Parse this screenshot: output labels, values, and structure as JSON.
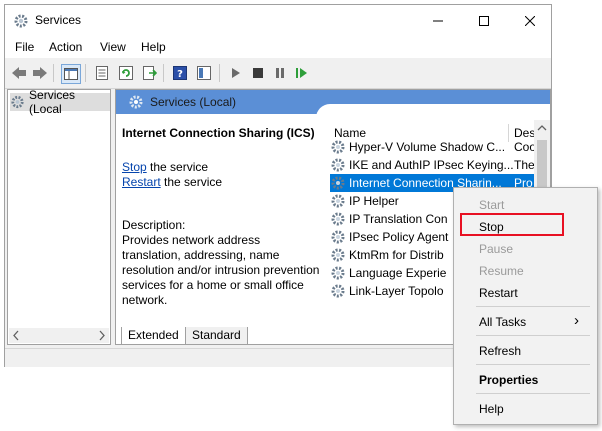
{
  "window": {
    "title": "Services",
    "controls": {
      "minimize": "—",
      "maximize": "☐",
      "close": "✕"
    }
  },
  "menu": [
    "File",
    "Action",
    "View",
    "Help"
  ],
  "tree": {
    "root_label": "Services (Local"
  },
  "content": {
    "header_title": "Services (Local)",
    "service_title": "Internet Connection Sharing (ICS)",
    "stop_link": "Stop",
    "stop_suffix": " the service",
    "restart_link": "Restart",
    "restart_suffix": " the service",
    "description_label": "Description:",
    "description_text": "Provides network address translation, addressing, name resolution and/or intrusion prevention services for a home or small office network."
  },
  "list": {
    "col_name": "Name",
    "col_desc": "Des",
    "rows": [
      {
        "name": "Hyper-V Volume Shadow C...",
        "desc": "Coo"
      },
      {
        "name": "IKE and AuthIP IPsec Keying...",
        "desc": "The"
      },
      {
        "name": "Internet Connection Sharin...",
        "desc": "Pro"
      },
      {
        "name": "IP Helper",
        "desc": ""
      },
      {
        "name": "IP Translation Con",
        "desc": ""
      },
      {
        "name": "IPsec Policy Agent",
        "desc": ""
      },
      {
        "name": "KtmRm for Distrib",
        "desc": ""
      },
      {
        "name": "Language Experie",
        "desc": ""
      },
      {
        "name": "Link-Layer Topolo",
        "desc": ""
      }
    ],
    "selected_index": 2
  },
  "tabs": [
    "Extended",
    "Standard"
  ],
  "context_menu": {
    "start": "Start",
    "stop": "Stop",
    "pause": "Pause",
    "resume": "Resume",
    "restart": "Restart",
    "all_tasks": "All Tasks",
    "all_tasks_arrow": "›",
    "refresh": "Refresh",
    "properties": "Properties",
    "help": "Help"
  },
  "colors": {
    "accent": "#0078d7",
    "header": "#5b8fd6",
    "highlight_box": "#e81123"
  }
}
